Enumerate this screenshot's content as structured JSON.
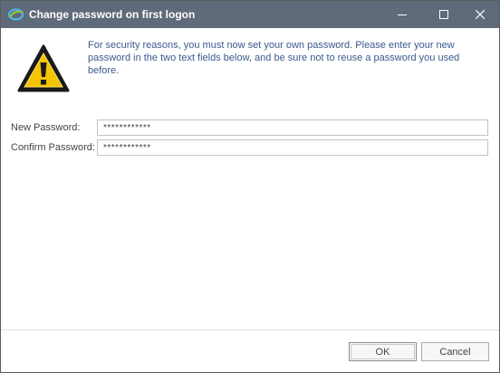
{
  "window": {
    "title": "Change password on first logon",
    "controls": {
      "minimize_icon": "minimize-icon",
      "maximize_icon": "maximize-icon",
      "close_icon": "close-icon"
    },
    "app_icon": "app-logo-icon"
  },
  "message": {
    "icon": "warning-icon",
    "text": "For security reasons, you must now set your own password. Please enter your new password in the two text fields below, and be sure not to reuse a password you used before."
  },
  "form": {
    "new_password": {
      "label": "New Password:",
      "value": "************"
    },
    "confirm_password": {
      "label": "Confirm Password:",
      "value": "************"
    }
  },
  "buttons": {
    "ok_label": "OK",
    "cancel_label": "Cancel"
  },
  "colors": {
    "titlebar": "#5f6a7a",
    "message_text": "#3a5a8c",
    "warning_fill": "#f5c400"
  }
}
